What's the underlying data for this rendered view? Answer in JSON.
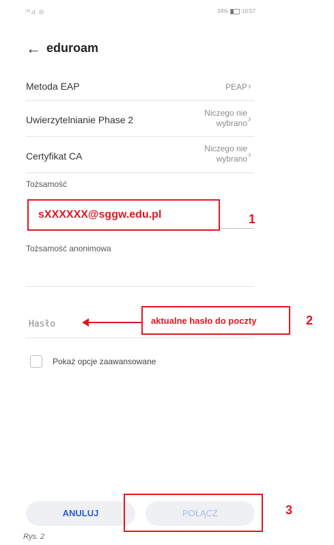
{
  "status_bar": {
    "left": "ⁱᴴ⊿ ◎",
    "right": "34%",
    "time": "10:57"
  },
  "header": {
    "title": "eduroam"
  },
  "rows": [
    {
      "label": "Metoda EAP",
      "value": "PEAP"
    },
    {
      "label": "Uwierzytelnianie Phase 2",
      "value_line1": "Niczego nie",
      "value_line2": "wybrano"
    },
    {
      "label": "Certyfikat CA",
      "value_line1": "Niczego nie",
      "value_line2": "wybrano"
    }
  ],
  "identity": {
    "label": "Tożsamość",
    "value": "sXXXXXX@sggw.edu.pl"
  },
  "anonymous_identity": {
    "label": "Tożsamość anonimowa"
  },
  "password": {
    "placeholder": "Hasło"
  },
  "advanced": {
    "label": "Pokaż opcje zaawansowane"
  },
  "buttons": {
    "cancel": "ANULUJ",
    "connect": "POŁĄCZ"
  },
  "annotations": {
    "num1": "1",
    "num2": "2",
    "num3": "3",
    "password_note": "aktualne hasło do poczty"
  },
  "caption": "Rys. 2",
  "colors": {
    "annotation_red": "#e0161f",
    "accent_blue": "#2a5dc9"
  }
}
